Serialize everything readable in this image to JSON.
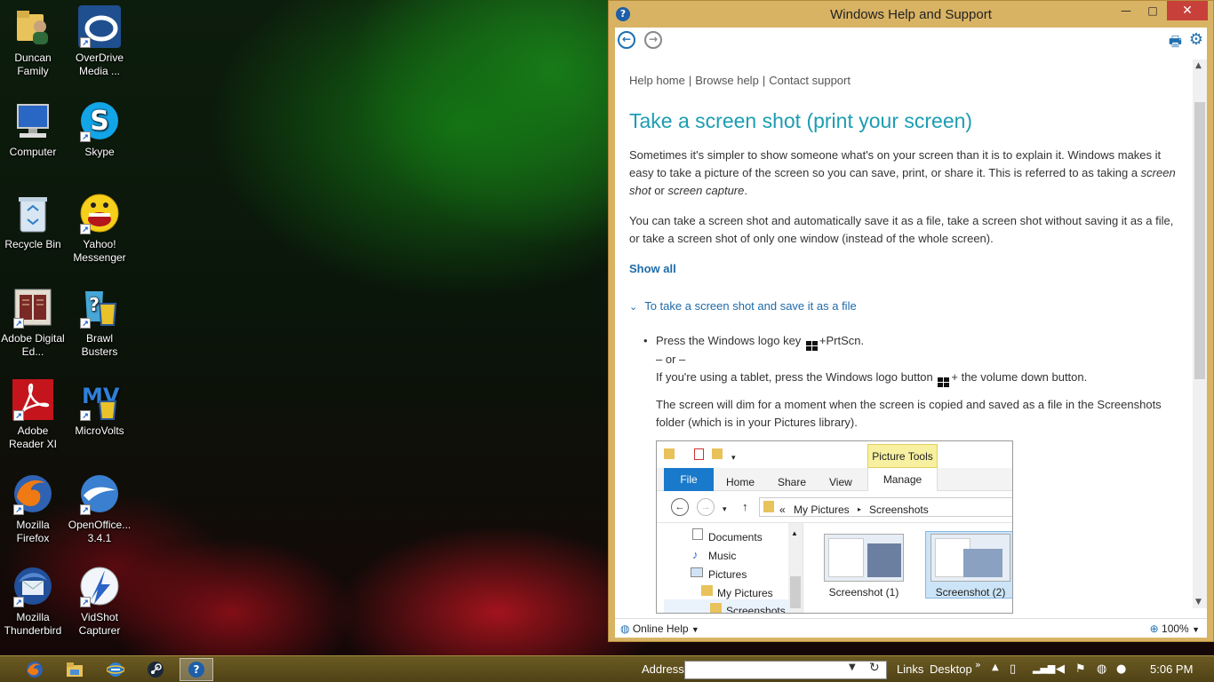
{
  "desktop": {
    "icons": [
      {
        "label": "Duncan Family",
        "icon": "user-folder-icon"
      },
      {
        "label": "OverDrive Media ...",
        "icon": "overdrive-icon"
      },
      {
        "label": "Computer",
        "icon": "computer-icon"
      },
      {
        "label": "Skype",
        "icon": "skype-icon"
      },
      {
        "label": "Recycle Bin",
        "icon": "recycle-bin-icon"
      },
      {
        "label": "Yahoo! Messenger",
        "icon": "yahoo-messenger-icon"
      },
      {
        "label": "Adobe Digital Ed...",
        "icon": "adobe-digital-editions-icon"
      },
      {
        "label": "Brawl Busters",
        "icon": "brawl-busters-icon"
      },
      {
        "label": "Adobe Reader XI",
        "icon": "adobe-reader-icon"
      },
      {
        "label": "MicroVolts",
        "icon": "microvolts-icon"
      },
      {
        "label": "Mozilla Firefox",
        "icon": "firefox-icon"
      },
      {
        "label": "OpenOffice... 3.4.1",
        "icon": "openoffice-icon"
      },
      {
        "label": "Mozilla Thunderbird",
        "icon": "thunderbird-icon"
      },
      {
        "label": "VidShot Capturer",
        "icon": "vidshot-icon"
      }
    ]
  },
  "window": {
    "title": "Windows Help and Support",
    "minimize": "—",
    "maximize": "□",
    "close": "✕"
  },
  "toolbar": {
    "back": "←",
    "forward": "→",
    "print": "🖶",
    "settings": "⚙"
  },
  "article": {
    "breadcrumbs": [
      "Help home",
      "Browse help",
      "Contact support"
    ],
    "title": "Take a screen shot (print your screen)",
    "para1_a": "Sometimes it's simpler to show someone what's on your screen than it is to explain it. Windows makes it easy to take a picture of the screen so you can save, print, or share it. This is referred to as taking a ",
    "para1_em1": "screen shot",
    "para1_mid": " or ",
    "para1_em2": "screen capture",
    "para1_end": ".",
    "para2": "You can take a screen shot and automatically save it as a file, take a screen shot without saving it as a file, or take a screen shot of only one window (instead of the whole screen).",
    "show_all": "Show all",
    "section_title": "To take a screen shot and save it as a file",
    "step1_a": "Press the Windows logo key ",
    "step1_b": "+PrtScn.",
    "step1_or": "– or –",
    "step1_c": "If you're using a tablet, press the Windows logo button ",
    "step1_d": "+ the volume down button.",
    "step2": "The screen will dim for a moment when the screen is copied and saved as a file in the Screenshots folder (which is in your Pictures library)."
  },
  "explorer_image": {
    "picture_tools": "Picture Tools",
    "tabs": [
      "File",
      "Home",
      "Share",
      "View",
      "Manage"
    ],
    "path_prefix": "«",
    "path": [
      "My Pictures",
      "Screenshots"
    ],
    "tree": [
      "Documents",
      "Music",
      "Pictures",
      "My Pictures",
      "Screenshots"
    ],
    "thumbs": [
      "Screenshot (1)",
      "Screenshot (2)"
    ]
  },
  "footer": {
    "online_help": "Online Help",
    "zoom": "100%"
  },
  "taskbar": {
    "address_label": "Address",
    "address_value": "",
    "links": "Links",
    "desktop": "Desktop",
    "more": "»",
    "clock": "5:06 PM"
  }
}
